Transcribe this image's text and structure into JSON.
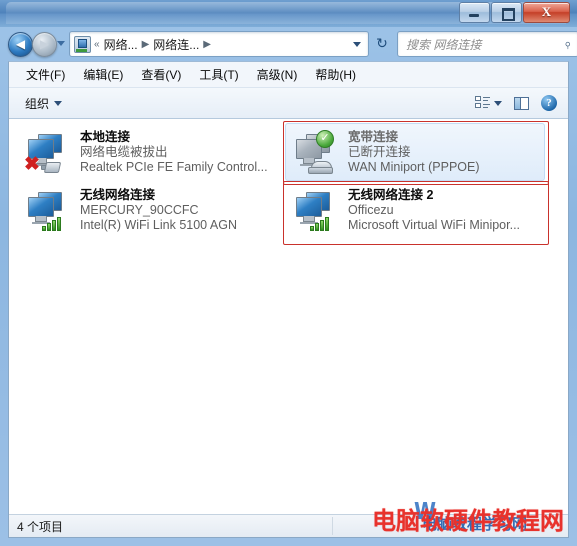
{
  "window": {
    "minimize_label": "最小化",
    "maximize_label": "最大化",
    "close_label": "X"
  },
  "nav": {
    "back_glyph": "◀",
    "forward_glyph": "▶",
    "breadcrumb": [
      {
        "label": "«"
      },
      {
        "label": "网络..."
      },
      {
        "label": "▶"
      },
      {
        "label": "网络连..."
      },
      {
        "label": "▶"
      }
    ],
    "refresh_glyph": "↻",
    "search_placeholder": "搜索 网络连接",
    "search_value": "",
    "search_icon_glyph": "⌕"
  },
  "menubar": {
    "items": [
      {
        "label": "文件(F)"
      },
      {
        "label": "编辑(E)"
      },
      {
        "label": "查看(V)"
      },
      {
        "label": "工具(T)"
      },
      {
        "label": "高级(N)"
      },
      {
        "label": "帮助(H)"
      }
    ]
  },
  "toolbar": {
    "organize_label": "组织",
    "help_glyph": "?"
  },
  "connections": [
    {
      "name": "本地连接",
      "status": "网络电缆被拔出",
      "device": "Realtek PCIe FE Family Control...",
      "icon": "two-monitors-icon",
      "overlay": "red-x-plug",
      "selected": false,
      "dimmed": false,
      "annotated": false
    },
    {
      "name": "宽带连接",
      "status": "已断开连接",
      "device": "WAN Miniport (PPPOE)",
      "icon": "monitor-modem-icon",
      "overlay": "green-check",
      "selected": true,
      "dimmed": true,
      "annotated": false
    },
    {
      "name": "无线网络连接",
      "status": "MERCURY_90CCFC",
      "device": "Intel(R) WiFi Link 5100 AGN",
      "icon": "two-monitors-icon",
      "overlay": "signal-bars",
      "selected": false,
      "dimmed": false,
      "annotated": false
    },
    {
      "name": "无线网络连接 2",
      "status": "Officezu",
      "device": "Microsoft Virtual WiFi Minipor...",
      "icon": "two-monitors-icon",
      "overlay": "signal-bars",
      "selected": false,
      "dimmed": false,
      "annotated": true
    }
  ],
  "statusbar": {
    "count_label": "4 个项目"
  },
  "watermark": {
    "red_text": "电脑软硬件教程网",
    "blue_text": "W",
    "blue_text2": "电脑教程学习网"
  },
  "colors": {
    "accent": "#2f6fae",
    "annotation": "#c9322c",
    "selection": "#dfecfa",
    "titlebar": "#4e82bb"
  }
}
